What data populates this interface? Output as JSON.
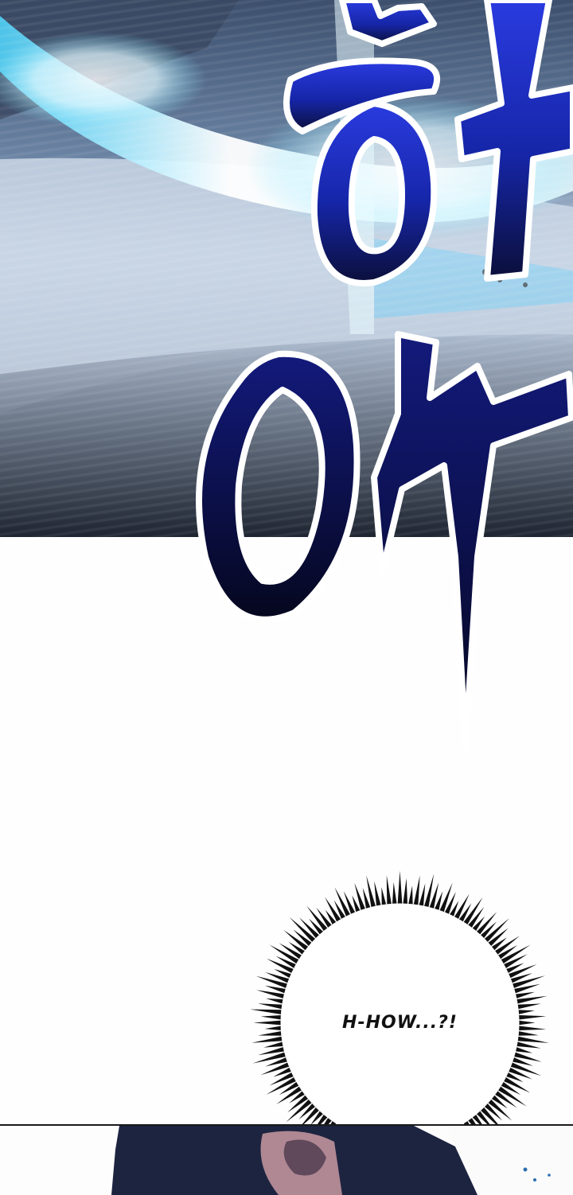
{
  "panels": {
    "top": {
      "sfx_syllable_1": "하",
      "sfx_syllable_2": "아"
    },
    "middle": {
      "speech_bubble": {
        "text": "H-HOW...?!",
        "style": "spiky-burst"
      }
    }
  },
  "colors": {
    "sfx_fill": "#1f2fd6",
    "sfx_dark": "#0d1247",
    "glow": "#bff4ff",
    "panel_border": "#1a1a1a",
    "background": "#fefefe"
  }
}
